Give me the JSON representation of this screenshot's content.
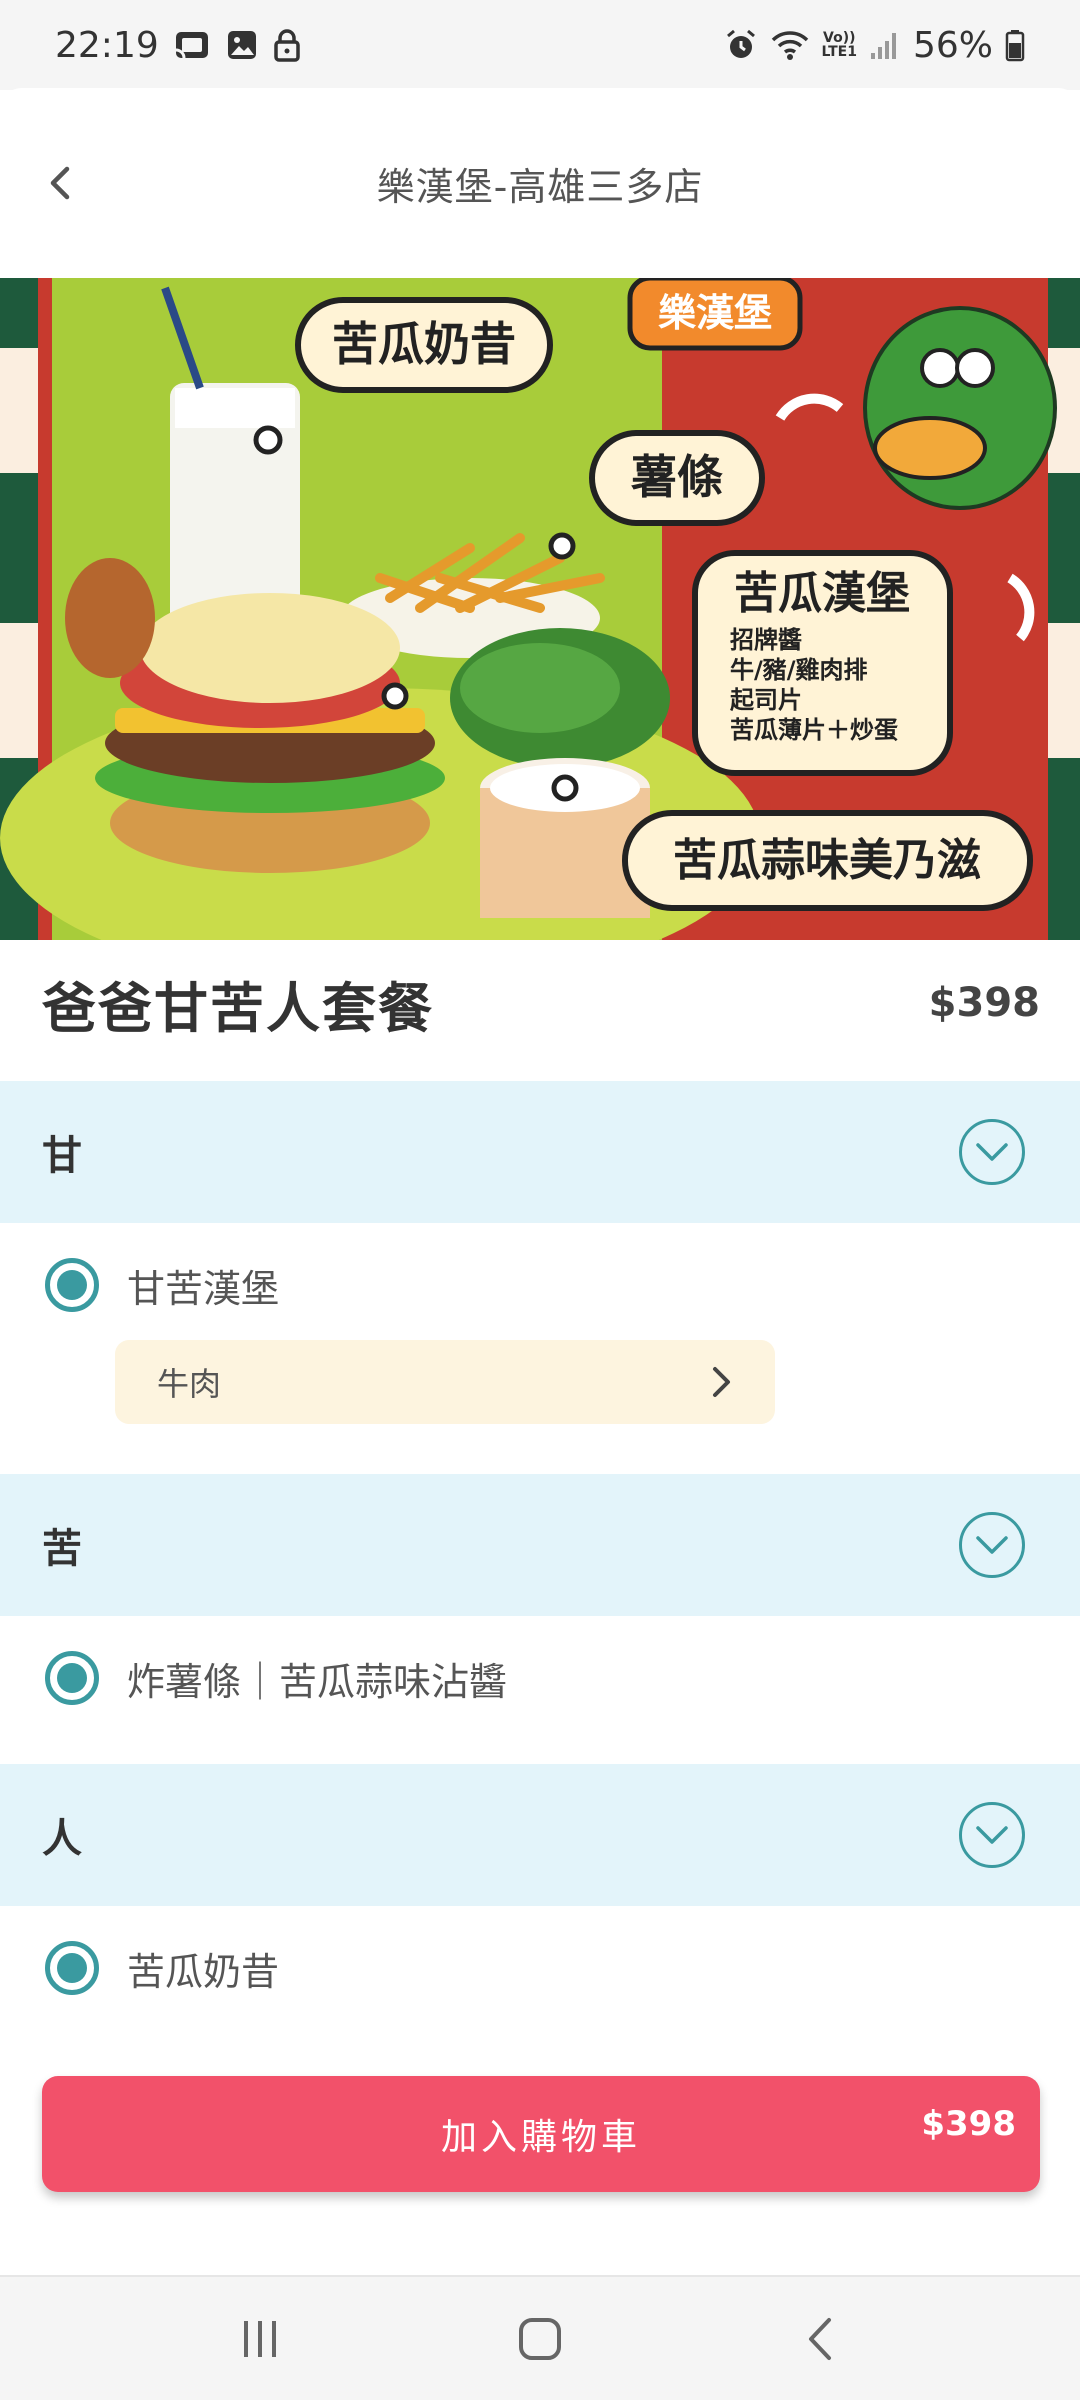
{
  "status_bar": {
    "time": "22:19",
    "battery": "56%",
    "lte_top": "Vo))",
    "lte_bottom": "LTE1"
  },
  "header": {
    "store_name": "樂漢堡-高雄三多店"
  },
  "hero": {
    "brand": "樂漢堡",
    "labels": {
      "milkshake": "苦瓜奶昔",
      "fries": "薯條",
      "burger_title": "苦瓜漢堡",
      "burger_desc": [
        "招牌醬",
        "牛/豬/雞肉排",
        "起司片",
        "苦瓜薄片＋炒蛋"
      ],
      "mayo": "苦瓜蒜味美乃滋"
    }
  },
  "product": {
    "name": "爸爸甘苦人套餐",
    "price": "$398"
  },
  "sections": [
    {
      "title": "甘",
      "option": "甘苦漢堡",
      "variant": "牛肉"
    },
    {
      "title": "苦",
      "option": "炸薯條｜苦瓜蒜味沾醬"
    },
    {
      "title": "人",
      "option": "苦瓜奶昔"
    }
  ],
  "cart": {
    "label": "加入購物車",
    "price": "$398"
  },
  "colors": {
    "accent": "#3a9aa0",
    "section_bg": "#e3f4fa",
    "variant_bg": "#fdf4df",
    "cart_button": "#f2516a"
  }
}
